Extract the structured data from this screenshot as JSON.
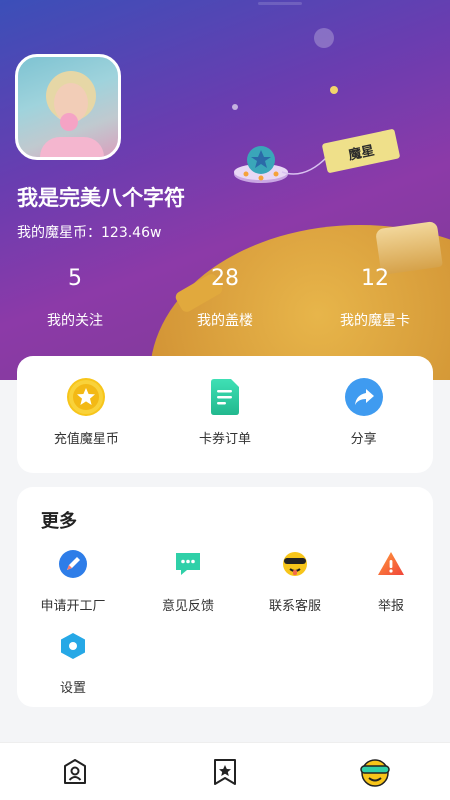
{
  "profile": {
    "username": "我是完美八个字符",
    "coins_label": "我的魔星币：123.46w",
    "flag_text": "魔星"
  },
  "stats": [
    {
      "value": "5",
      "label": "我的关注"
    },
    {
      "value": "28",
      "label": "我的盖楼"
    },
    {
      "value": "12",
      "label": "我的魔星卡"
    }
  ],
  "actions": [
    {
      "label": "充值魔星币",
      "icon": "star-coin-icon"
    },
    {
      "label": "卡券订单",
      "icon": "document-icon"
    },
    {
      "label": "分享",
      "icon": "share-icon"
    }
  ],
  "more": {
    "title": "更多",
    "items": [
      {
        "label": "申请开工厂",
        "icon": "pencil-icon"
      },
      {
        "label": "意见反馈",
        "icon": "chat-icon"
      },
      {
        "label": "联系客服",
        "icon": "support-emoji-icon"
      },
      {
        "label": "举报",
        "icon": "warning-icon"
      },
      {
        "label": "设置",
        "icon": "settings-hexagon-icon"
      }
    ]
  },
  "tabbar": [
    {
      "icon": "home-user-icon"
    },
    {
      "icon": "bookmark-star-icon"
    },
    {
      "icon": "profile-avatar-icon",
      "active": true
    }
  ],
  "colors": {
    "hero_gradient_start": "#3b4fb8",
    "hero_gradient_end": "#8c3aa8",
    "accent_blue": "#3f9bf0",
    "accent_yellow": "#f7c51a",
    "accent_green": "#2fd0a8"
  }
}
